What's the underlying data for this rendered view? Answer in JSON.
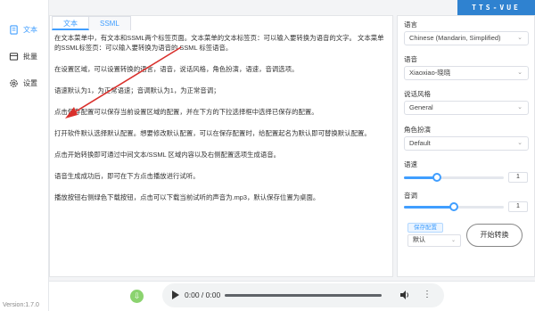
{
  "brand": "TTS-VUE",
  "sidebar": {
    "items": [
      {
        "label": "文本",
        "icon": "document-icon",
        "active": true
      },
      {
        "label": "批量",
        "icon": "batch-icon",
        "active": false
      },
      {
        "label": "设置",
        "icon": "gear-icon",
        "active": false
      }
    ],
    "version": "Version:1.7.0"
  },
  "editor": {
    "tabs": [
      {
        "label": "文本",
        "active": true
      },
      {
        "label": "SSML",
        "active": false
      }
    ],
    "paragraphs": [
      "在文本菜单中，有文本和SSML两个标签页面。文本菜单的文本标签页：可以输入要转换为语音的文字。 文本菜单的SSML标签页：可以输入要转换为语音的 SSML 标签语音。",
      "在设置区域，可以设置转换的语言，语音，说话风格，角色扮演，语速，音调选项。",
      "语速默认为1，为正常语速；音调默认为1，为正常音调；",
      "点击保存配置可以保存当前设置区域的配置，并在下方的下拉选择框中选择已保存的配置。",
      "打开软件默认选择默认配置。想要修改默认配置，可以在保存配置时，给配置起名为默认即可替换默认配置。",
      "点击开始转换即可通过中间文本/SSML 区域内容以及右侧配置选项生成语音。",
      "语音生成成功后，即可在下方点击播放进行试听。",
      "播放按钮右侧绿色下载按钮，点击可以下载当前试听的声音为.mp3，默认保存位置为桌面。"
    ]
  },
  "settings": {
    "language_label": "语言",
    "language_value": "Chinese (Mandarin, Simplified)",
    "voice_label": "语音",
    "voice_value": "Xiaoxiao-晓晓",
    "style_label": "说话风格",
    "style_value": "General",
    "role_label": "角色扮演",
    "role_value": "Default",
    "speed_label": "语速",
    "speed_value": "1",
    "speed_fraction": 0.33,
    "pitch_label": "音调",
    "pitch_value": "1",
    "pitch_fraction": 0.5,
    "save_config_label": "保存配置",
    "config_value": "默认",
    "start_label": "开始转换"
  },
  "player": {
    "time": "0:00 / 0:00",
    "download_icon": "download-icon"
  }
}
